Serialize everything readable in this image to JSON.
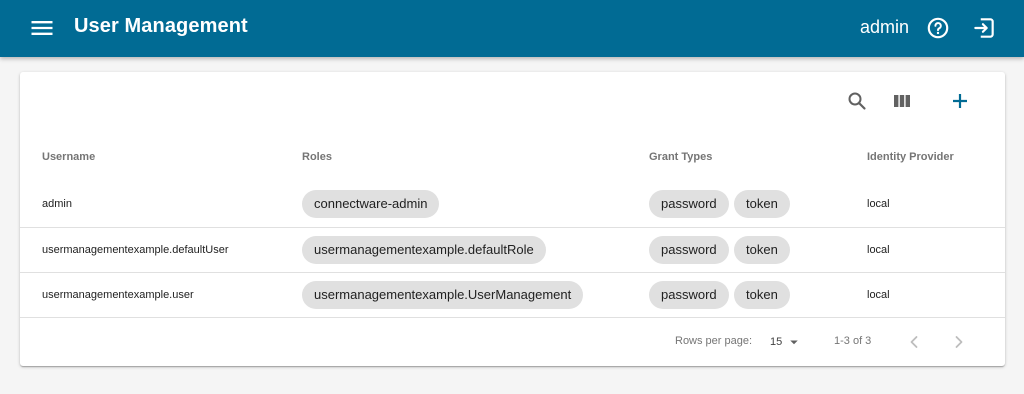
{
  "appbar": {
    "menu_icon": "menu-icon",
    "title": "User Management",
    "username": "admin",
    "help_icon": "help-circle-icon",
    "logout_icon": "logout-icon",
    "color": "#016b94"
  },
  "toolbar": {
    "search_icon": "search-icon",
    "columns_icon": "view-columns-icon",
    "add_icon": "add-icon",
    "accent": "#016b94"
  },
  "table": {
    "columns": [
      "Username",
      "Roles",
      "Grant Types",
      "Identity Provider"
    ],
    "rows": [
      {
        "username": "admin",
        "roles": [
          "connectware-admin"
        ],
        "grant_types": [
          "password",
          "token"
        ],
        "provider": "local"
      },
      {
        "username": "usermanagementexample.defaultUser",
        "roles": [
          "usermanagementexample.defaultRole"
        ],
        "grant_types": [
          "password",
          "token"
        ],
        "provider": "local"
      },
      {
        "username": "usermanagementexample.user",
        "roles": [
          "usermanagementexample.UserManagement"
        ],
        "grant_types": [
          "password",
          "token"
        ],
        "provider": "local"
      }
    ]
  },
  "pagination": {
    "rows_per_page_label": "Rows per page:",
    "rows_per_page_value": "15",
    "range_text": "1-3 of 3",
    "prev_icon": "chevron-left-icon",
    "next_icon": "chevron-right-icon"
  }
}
